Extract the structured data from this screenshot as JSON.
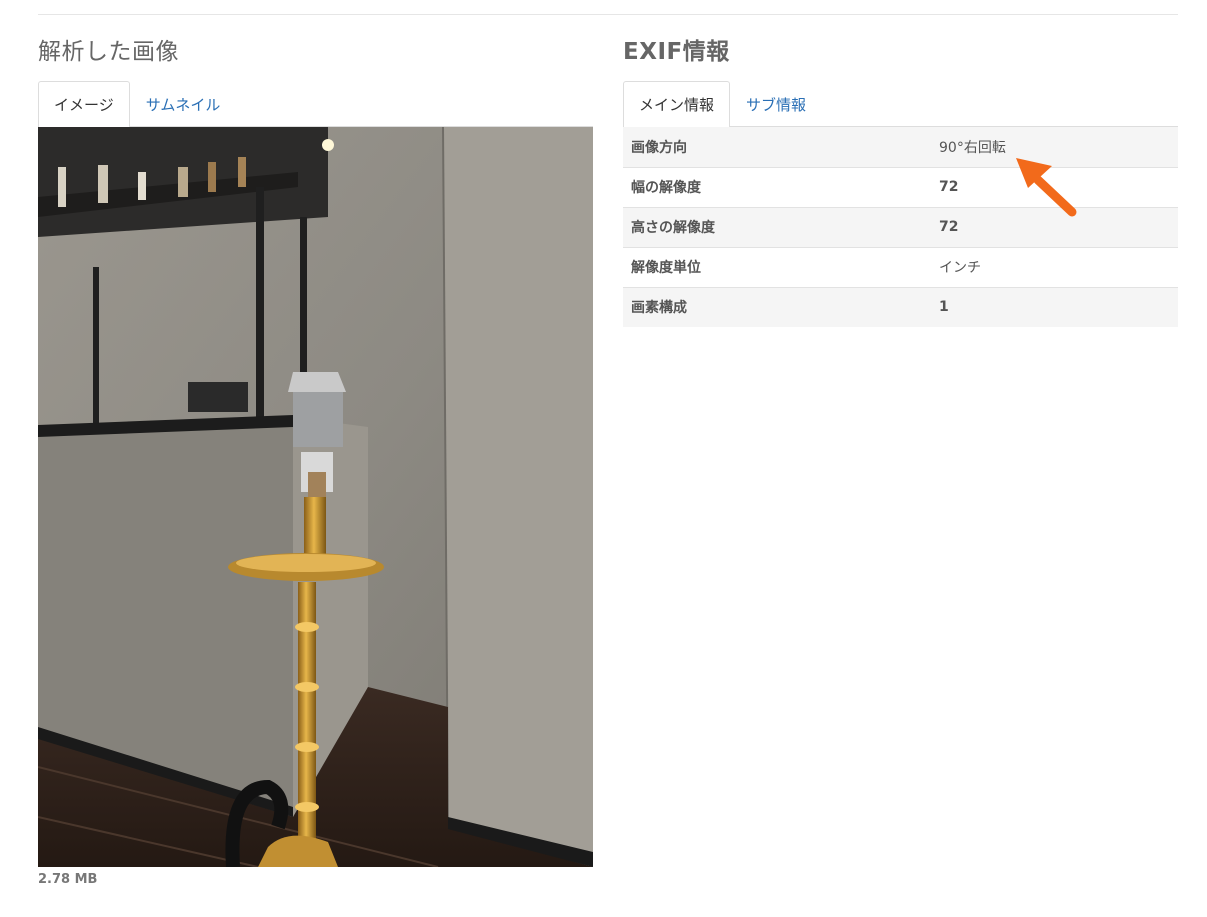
{
  "left_panel": {
    "title": "解析した画像",
    "tabs": [
      {
        "label": "イメージ",
        "active": true
      },
      {
        "label": "サムネイル",
        "active": false
      }
    ],
    "file_size": "2.78 MB"
  },
  "right_panel": {
    "title": "EXIF情報",
    "tabs": [
      {
        "label": "メイン情報",
        "active": true
      },
      {
        "label": "サブ情報",
        "active": false
      }
    ],
    "rows": [
      {
        "key": "画像方向",
        "value": "90°右回転"
      },
      {
        "key": "幅の解像度",
        "value": "72"
      },
      {
        "key": "高さの解像度",
        "value": "72"
      },
      {
        "key": "解像度単位",
        "value": "インチ"
      },
      {
        "key": "画素構成",
        "value": "1"
      }
    ]
  },
  "colors": {
    "link": "#2a6fb5",
    "annotation_arrow": "#f26a1b",
    "row_stripe": "#f5f5f5"
  }
}
